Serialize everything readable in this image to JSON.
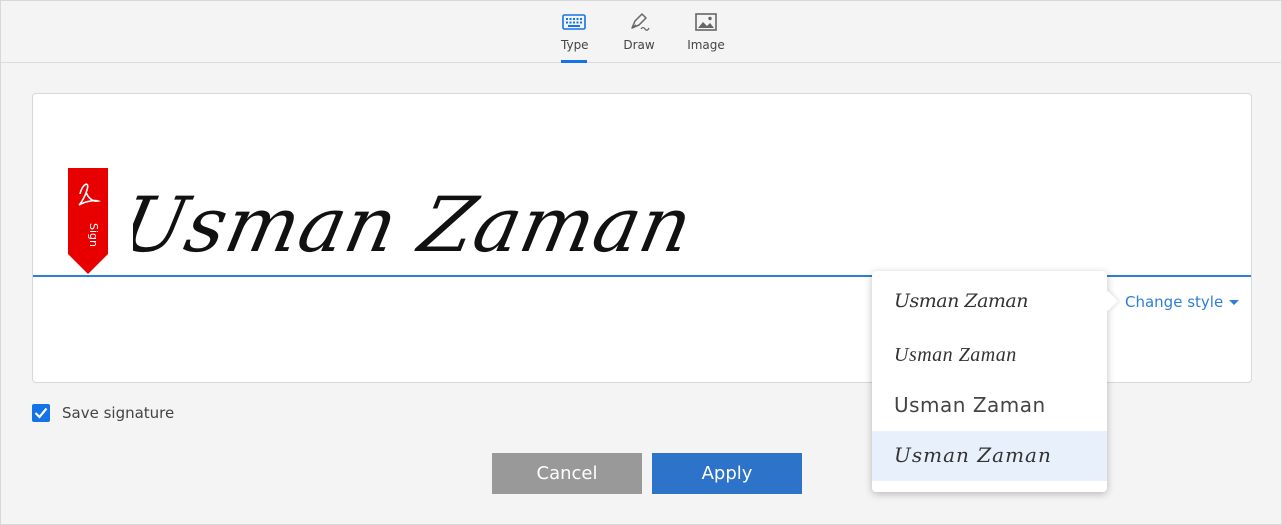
{
  "tabs": [
    {
      "label": "Type",
      "icon": "keyboard-icon",
      "active": true
    },
    {
      "label": "Draw",
      "icon": "pen-icon",
      "active": false
    },
    {
      "label": "Image",
      "icon": "image-icon",
      "active": false
    }
  ],
  "signature": {
    "text": "Usman Zaman",
    "flag_label": "Sign",
    "flag_icon": "adobe-acrobat-icon"
  },
  "change_style": {
    "label": "Change style",
    "options": [
      "Usman Zaman",
      "Usman Zaman",
      "Usman Zaman",
      "Usman Zaman"
    ],
    "selected_index": 3
  },
  "save_signature": {
    "label": "Save signature",
    "checked": true
  },
  "buttons": {
    "cancel": "Cancel",
    "apply": "Apply"
  },
  "colors": {
    "accent": "#1473e6",
    "flag": "#e80000",
    "apply": "#2d73c9",
    "cancel": "#999999"
  }
}
